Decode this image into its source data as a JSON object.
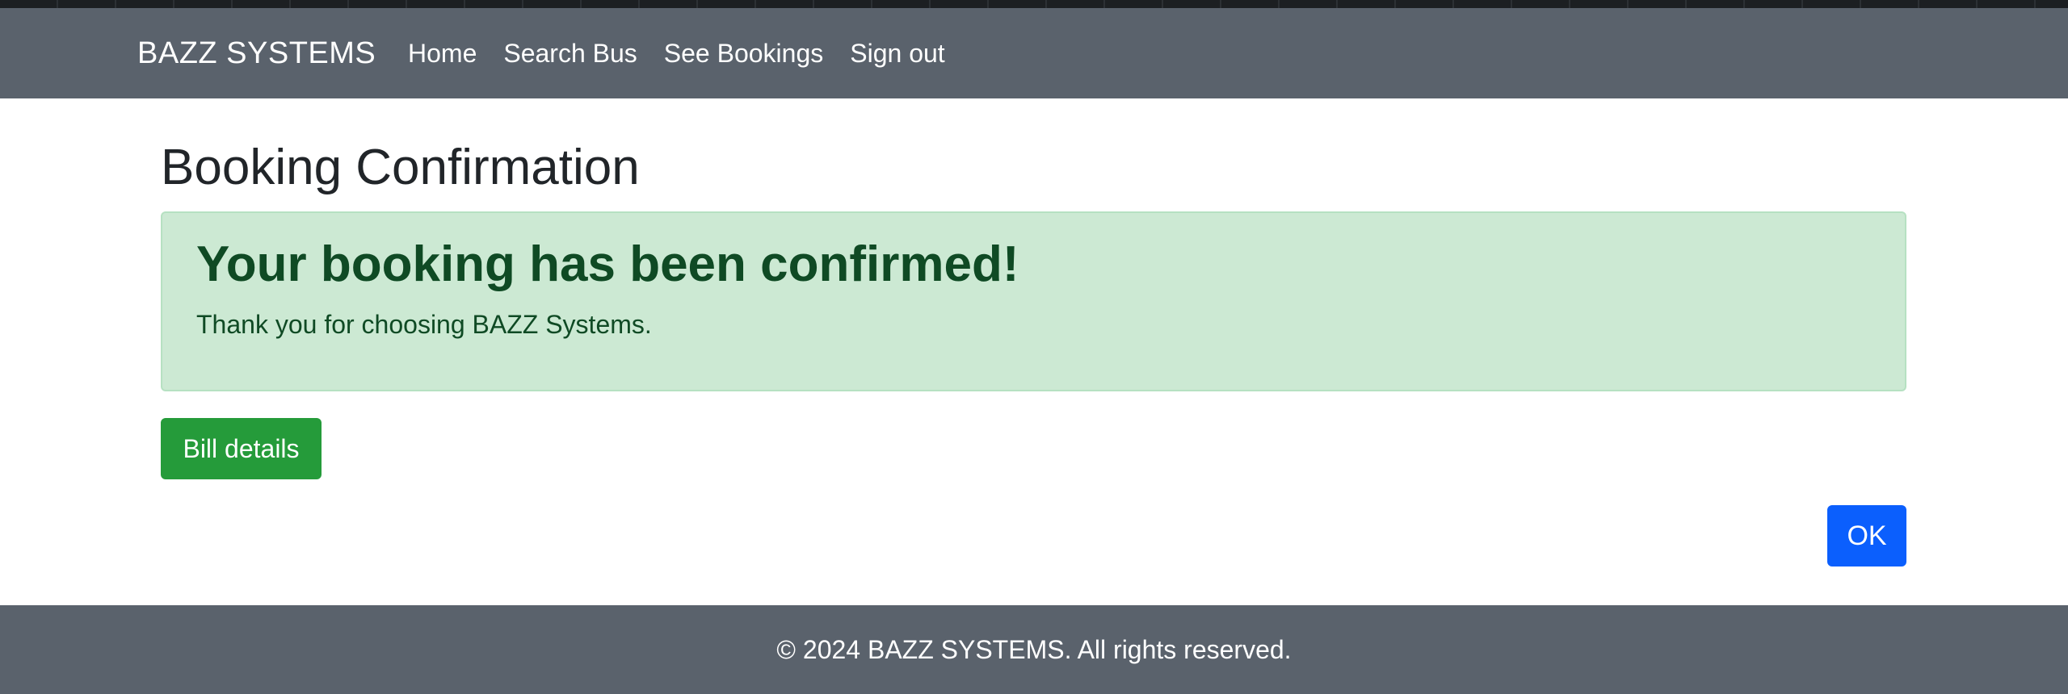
{
  "navbar": {
    "brand": "BAZZ SYSTEMS",
    "links": [
      {
        "label": "Home"
      },
      {
        "label": "Search Bus"
      },
      {
        "label": "See Bookings"
      },
      {
        "label": "Sign out"
      }
    ]
  },
  "main": {
    "title": "Booking Confirmation",
    "alert": {
      "heading": "Your booking has been confirmed!",
      "text": "Thank you for choosing BAZZ Systems."
    },
    "bill_button_label": "Bill details",
    "ok_button_label": "OK"
  },
  "footer": {
    "text": "© 2024 BAZZ SYSTEMS. All rights reserved."
  },
  "colors": {
    "navbar_bg": "#5a626c",
    "alert_bg": "#cce9d3",
    "alert_text": "#0f4a24",
    "success_button": "#259b3a",
    "primary_button": "#0b5ffd"
  }
}
